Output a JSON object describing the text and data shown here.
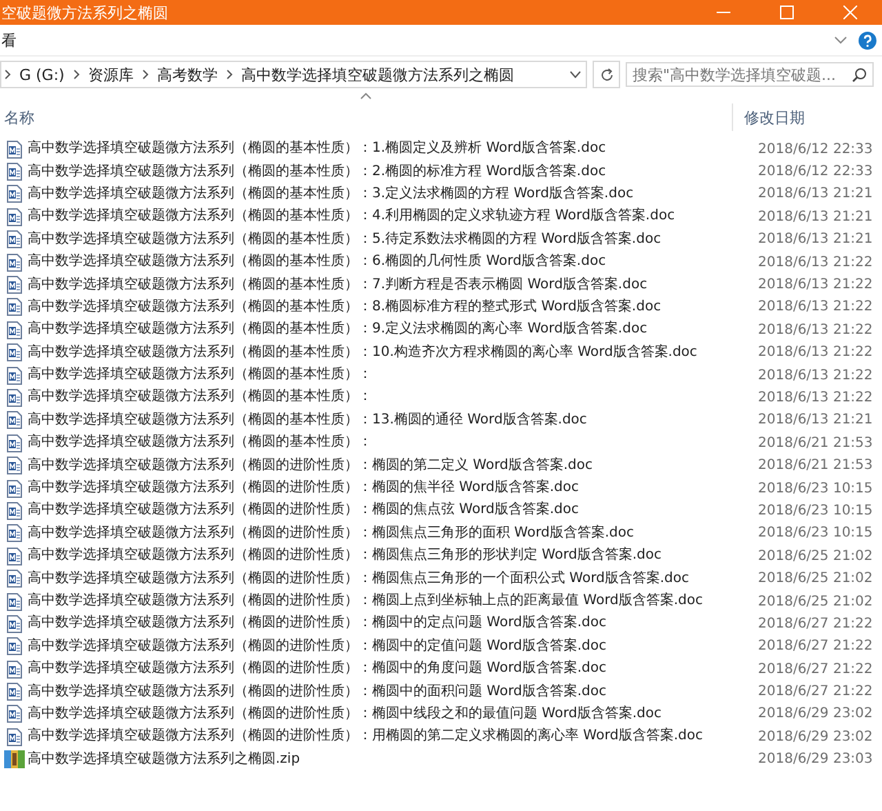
{
  "window": {
    "title": "空破题微方法系列之椭圆"
  },
  "ribbon": {
    "tab": "看"
  },
  "address": {
    "path": [
      "G (G:)",
      "资源库",
      "高考数学",
      "高中数学选择填空破题微方法系列之椭圆"
    ]
  },
  "search": {
    "placeholder": "搜索\"高中数学选择填空破题..."
  },
  "columns": [
    "名称",
    "修改日期"
  ],
  "rows": [
    {
      "kind": "doc",
      "name": "高中数学选择填空破题微方法系列（椭圆的基本性质）：1.椭圆定义及辨析 Word版含答案.doc",
      "modified": "2018/6/12 22:33"
    },
    {
      "kind": "doc",
      "name": "高中数学选择填空破题微方法系列（椭圆的基本性质）：2.椭圆的标准方程 Word版含答案.doc",
      "modified": "2018/6/12 22:33"
    },
    {
      "kind": "doc",
      "name": "高中数学选择填空破题微方法系列（椭圆的基本性质）：3.定义法求椭圆的方程 Word版含答案.doc",
      "modified": "2018/6/13 21:21"
    },
    {
      "kind": "doc",
      "name": "高中数学选择填空破题微方法系列（椭圆的基本性质）：4.利用椭圆的定义求轨迹方程 Word版含答案.doc",
      "modified": "2018/6/13 21:21"
    },
    {
      "kind": "doc",
      "name": "高中数学选择填空破题微方法系列（椭圆的基本性质）：5.待定系数法求椭圆的方程 Word版含答案.doc",
      "modified": "2018/6/13 21:21"
    },
    {
      "kind": "doc",
      "name": "高中数学选择填空破题微方法系列（椭圆的基本性质）：6.椭圆的几何性质 Word版含答案.doc",
      "modified": "2018/6/13 21:22"
    },
    {
      "kind": "doc",
      "name": "高中数学选择填空破题微方法系列（椭圆的基本性质）：7.判断方程是否表示椭圆 Word版含答案.doc",
      "modified": "2018/6/13 21:22"
    },
    {
      "kind": "doc",
      "name": "高中数学选择填空破题微方法系列（椭圆的基本性质）：8.椭圆标准方程的整式形式 Word版含答案.doc",
      "modified": "2018/6/13 21:22"
    },
    {
      "kind": "doc",
      "name": "高中数学选择填空破题微方法系列（椭圆的基本性质）：9.定义法求椭圆的离心率 Word版含答案.doc",
      "modified": "2018/6/13 21:22"
    },
    {
      "kind": "doc",
      "name": "高中数学选择填空破题微方法系列（椭圆的基本性质）：10.构造齐次方程求椭圆的离心率 Word版含答案.doc",
      "modified": "2018/6/13 21:22"
    },
    {
      "kind": "doc",
      "name": "高中数学选择填空破题微方法系列（椭圆的基本性质）：",
      "modified": "2018/6/13 21:22"
    },
    {
      "kind": "doc",
      "name": "高中数学选择填空破题微方法系列（椭圆的基本性质）：",
      "modified": "2018/6/13 21:22"
    },
    {
      "kind": "doc",
      "name": "高中数学选择填空破题微方法系列（椭圆的基本性质）：13.椭圆的通径 Word版含答案.doc",
      "modified": "2018/6/13 21:21"
    },
    {
      "kind": "doc",
      "name": "高中数学选择填空破题微方法系列（椭圆的基本性质）：",
      "modified": "2018/6/21 21:53"
    },
    {
      "kind": "doc",
      "name": "高中数学选择填空破题微方法系列（椭圆的进阶性质）：椭圆的第二定义 Word版含答案.doc",
      "modified": "2018/6/21 21:53"
    },
    {
      "kind": "doc",
      "name": "高中数学选择填空破题微方法系列（椭圆的进阶性质）：椭圆的焦半径 Word版含答案.doc",
      "modified": "2018/6/23 10:15"
    },
    {
      "kind": "doc",
      "name": "高中数学选择填空破题微方法系列（椭圆的进阶性质）：椭圆的焦点弦 Word版含答案.doc",
      "modified": "2018/6/23 10:15"
    },
    {
      "kind": "doc",
      "name": "高中数学选择填空破题微方法系列（椭圆的进阶性质）：椭圆焦点三角形的面积 Word版含答案.doc",
      "modified": "2018/6/23 10:15"
    },
    {
      "kind": "doc",
      "name": "高中数学选择填空破题微方法系列（椭圆的进阶性质）：椭圆焦点三角形的形状判定 Word版含答案.doc",
      "modified": "2018/6/25 21:02"
    },
    {
      "kind": "doc",
      "name": "高中数学选择填空破题微方法系列（椭圆的进阶性质）：椭圆焦点三角形的一个面积公式 Word版含答案.doc",
      "modified": "2018/6/25 21:02"
    },
    {
      "kind": "doc",
      "name": "高中数学选择填空破题微方法系列（椭圆的进阶性质）：椭圆上点到坐标轴上点的距离最值 Word版含答案.doc",
      "modified": "2018/6/25 21:02"
    },
    {
      "kind": "doc",
      "name": "高中数学选择填空破题微方法系列（椭圆的进阶性质）：椭圆中的定点问题 Word版含答案.doc",
      "modified": "2018/6/27 21:22"
    },
    {
      "kind": "doc",
      "name": "高中数学选择填空破题微方法系列（椭圆的进阶性质）：椭圆中的定值问题 Word版含答案.doc",
      "modified": "2018/6/27 21:22"
    },
    {
      "kind": "doc",
      "name": "高中数学选择填空破题微方法系列（椭圆的进阶性质）：椭圆中的角度问题 Word版含答案.doc",
      "modified": "2018/6/27 21:22"
    },
    {
      "kind": "doc",
      "name": "高中数学选择填空破题微方法系列（椭圆的进阶性质）：椭圆中的面积问题 Word版含答案.doc",
      "modified": "2018/6/27 21:22"
    },
    {
      "kind": "doc",
      "name": "高中数学选择填空破题微方法系列（椭圆的进阶性质）：椭圆中线段之和的最值问题 Word版含答案.doc",
      "modified": "2018/6/29 23:02"
    },
    {
      "kind": "doc",
      "name": "高中数学选择填空破题微方法系列（椭圆的进阶性质）：用椭圆的第二定义求椭圆的离心率 Word版含答案.doc",
      "modified": "2018/6/29 23:02"
    },
    {
      "kind": "zip",
      "name": "高中数学选择填空破题微方法系列之椭圆.zip",
      "modified": "2018/6/29 23:03"
    }
  ]
}
